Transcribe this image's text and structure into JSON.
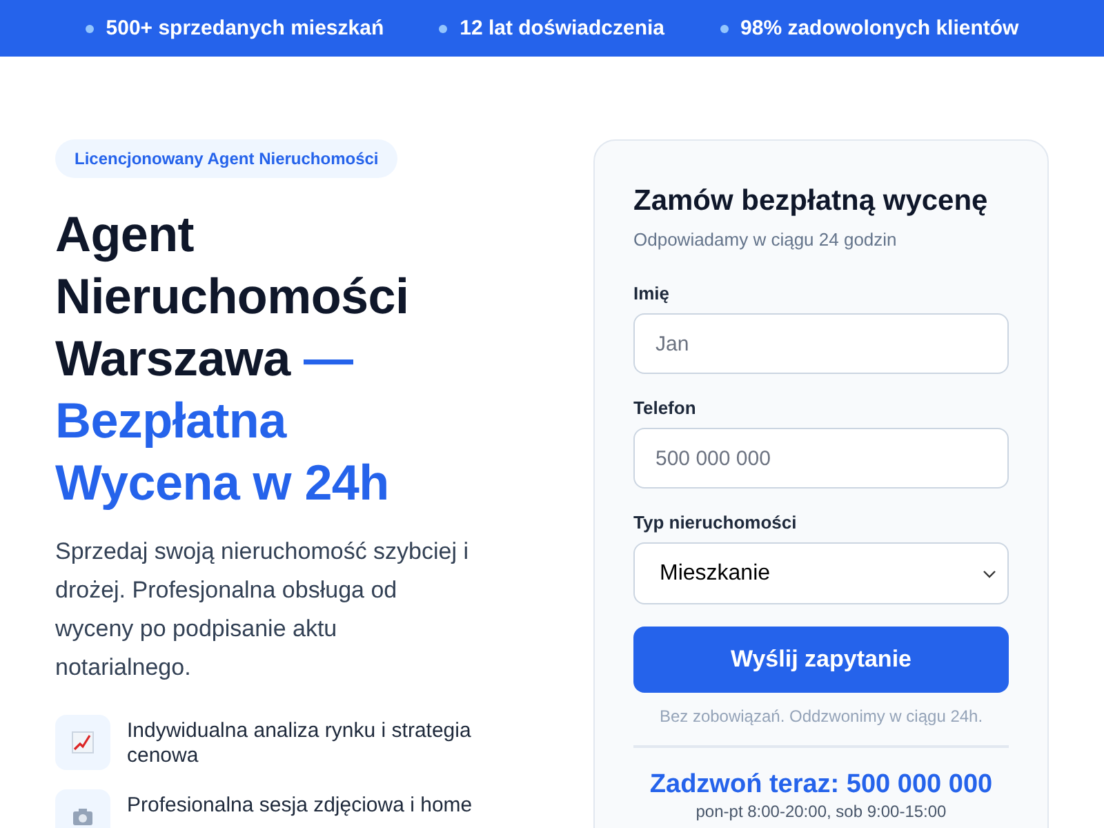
{
  "top_bar": {
    "items": [
      "500+ sprzedanych mieszkań",
      "12 lat doświadczenia",
      "98% zadowolonych klientów"
    ]
  },
  "hero": {
    "badge": "Licencjonowany Agent Nieruchomości",
    "heading_dark": "Agent Nieruchomości Warszawa",
    "heading_accent": "— Bezpłatna Wycena w 24h",
    "lead": "Sprzedaj swoją nieruchomość szybciej i drożej. Profesjonalna obsługa od wyceny po podpisanie aktu notarialnego.",
    "features": [
      {
        "kind": "chart",
        "text": "Indywidualna analiza rynku i strategia cenowa"
      },
      {
        "kind": "camera",
        "text": "Profesionalna sesja zdjęciowa i home"
      }
    ]
  },
  "form": {
    "title": "Zamów bezpłatną wycenę",
    "subtitle": "Odpowiadamy w ciągu 24 godzin",
    "fields": [
      {
        "kind": "text",
        "label": "Imię",
        "placeholder": "Jan"
      },
      {
        "kind": "text",
        "label": "Telefon",
        "placeholder": "500 000 000"
      },
      {
        "kind": "select",
        "label": "Typ nieruchomości",
        "value": "Mieszkanie"
      }
    ],
    "submit": "Wyślij zapytanie",
    "note": "Bez zobowiązań. Oddzwonimy w ciągu 24h.",
    "call": "Zadzwoń teraz: 500 000 000",
    "hours": "pon-pt 8:00-20:00, sob 9:00-15:00"
  }
}
